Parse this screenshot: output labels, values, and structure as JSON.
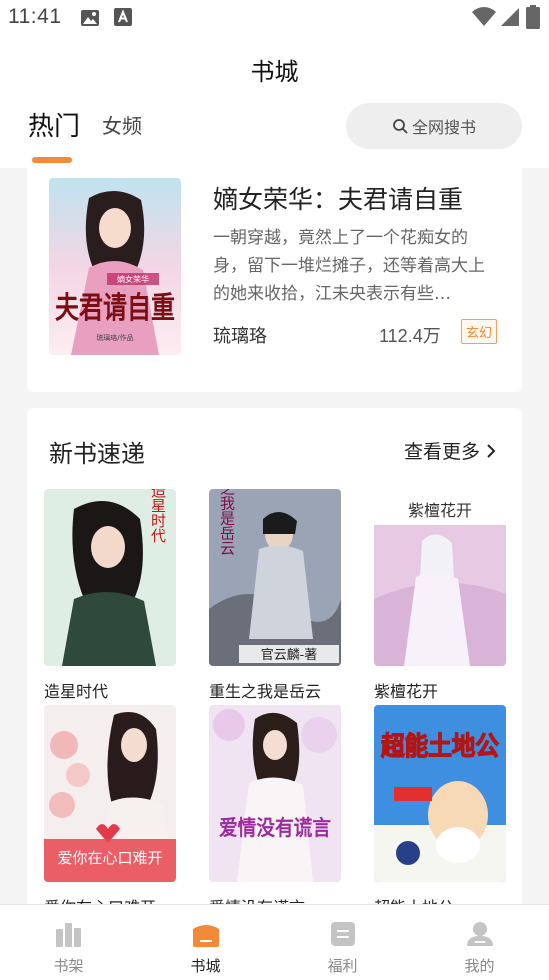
{
  "status_bar": {
    "time": "11:41"
  },
  "header": {
    "title": "书城",
    "tabs": [
      {
        "label": "热门"
      },
      {
        "label": "女频"
      }
    ],
    "search_label": "全网搜书"
  },
  "featured": {
    "title": "嫡女荣华：夫君请自重",
    "description": "一朝穿越，竟然上了一个花痴女的身，留下一堆烂摊子，还等着高大上的她来收拾，江未央表示有些…",
    "author": "琉璃珞",
    "count_number": "112.4",
    "count_unit": "万",
    "tag": "玄幻",
    "cover_text": {
      "label": "嫡女荣华",
      "main": "夫君请自重",
      "author": "琉璃珞/作品"
    }
  },
  "new_books": {
    "title": "新书速递",
    "more_label": "查看更多",
    "books": [
      {
        "title": "造星时代",
        "cover_text": "造星时代"
      },
      {
        "title": "重生之我是岳云",
        "cover_text": "重生之我是岳云",
        "cover_author": "官云麟-著"
      },
      {
        "title": "紫檀花开",
        "cover_text": "紫檀花开"
      },
      {
        "title": "爱你在心口难开",
        "cover_text": "爱你在心口难开"
      },
      {
        "title": "爱情没有谎言",
        "cover_text": "爱情没有谎言"
      },
      {
        "title": "超能土地公",
        "cover_text": "超能土地公"
      }
    ]
  },
  "bottom_nav": {
    "items": [
      {
        "label": "书架"
      },
      {
        "label": "书城"
      },
      {
        "label": "福利"
      },
      {
        "label": "我的"
      }
    ]
  },
  "colors": {
    "accent": "#f28a3a",
    "inactive": "#bbbbbb"
  }
}
